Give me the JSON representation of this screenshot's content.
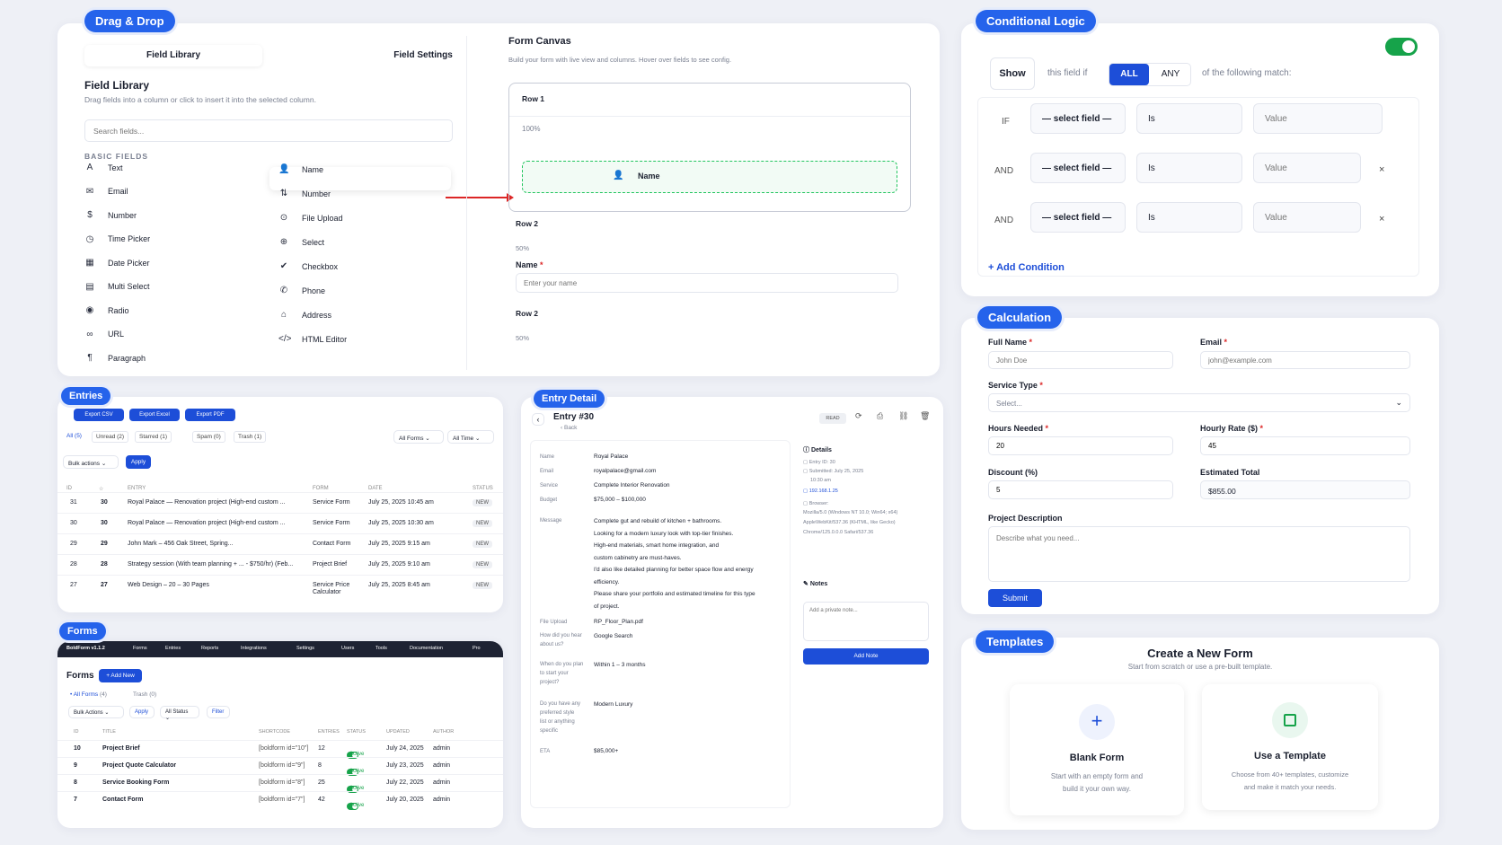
{
  "dragdrop": {
    "pill": "Drag & Drop",
    "tabs": [
      "Field Library",
      "Field Settings"
    ],
    "library_title": "Field Library",
    "library_desc": "Drag fields into a column or click to insert it into the selected column.",
    "search_placeholder": "Search fields...",
    "section": "BASIC FIELDS",
    "left_fields": [
      {
        "icon": "A",
        "label": "Text"
      },
      {
        "icon": "✉",
        "label": "Email"
      },
      {
        "icon": "$",
        "label": "Number"
      },
      {
        "icon": "◷",
        "label": "Time Picker"
      },
      {
        "icon": "▦",
        "label": "Date Picker"
      },
      {
        "icon": "▤",
        "label": "Multi Select"
      },
      {
        "icon": "◉",
        "label": "Radio"
      },
      {
        "icon": "∞",
        "label": "URL"
      },
      {
        "icon": "¶",
        "label": "Paragraph"
      }
    ],
    "right_fields": [
      {
        "icon": "👤",
        "label": "Name"
      },
      {
        "icon": "⇅",
        "label": "Number"
      },
      {
        "icon": "⊙",
        "label": "File Upload"
      },
      {
        "icon": "⊕",
        "label": "Select"
      },
      {
        "icon": "✔",
        "label": "Checkbox"
      },
      {
        "icon": "✆",
        "label": "Phone"
      },
      {
        "icon": "⌂",
        "label": "Address"
      },
      {
        "icon": "</>",
        "label": "HTML Editor"
      }
    ],
    "canvas_title": "Form Canvas",
    "canvas_desc": "Build your form with live view and columns. Hover over fields to see config.",
    "row1": "Row 1",
    "row1_width": "100%",
    "drop_label": "Name",
    "row2": "Row 2",
    "row2_width": "50%",
    "name_label": "Name",
    "name_placeholder": "Enter your name",
    "row3": "Row 2",
    "row3_width": "50%"
  },
  "conditional": {
    "pill": "Conditional Logic",
    "show": "Show",
    "this_field_if": "this field if",
    "all": "ALL",
    "any": "ANY",
    "of_following": "of the following match:",
    "rows": [
      {
        "op": "IF",
        "field": "— select field —",
        "cond": "Is",
        "value": "Value",
        "remove": ""
      },
      {
        "op": "AND",
        "field": "— select field —",
        "cond": "Is",
        "value": "Value",
        "remove": "×"
      },
      {
        "op": "AND",
        "field": "— select field —",
        "cond": "Is",
        "value": "Value",
        "remove": "×"
      }
    ],
    "add_condition": "+ Add Condition"
  },
  "calculation": {
    "pill": "Calculation",
    "full_name_label": "Full Name",
    "full_name_ph": "John Doe",
    "email_label": "Email",
    "email_ph": "john@example.com",
    "service_label": "Service Type",
    "service_ph": "Select...",
    "hours_label": "Hours Needed",
    "hours_val": "20",
    "rate_label": "Hourly Rate ($)",
    "rate_val": "45",
    "discount_label": "Discount (%)",
    "discount_val": "5",
    "total_label": "Estimated Total",
    "total_val": "$855.00",
    "desc_label": "Project Description",
    "desc_ph": "Describe what you need...",
    "submit": "Submit",
    "req": "*"
  },
  "templates": {
    "pill": "Templates",
    "title": "Create a New Form",
    "subtitle": "Start from scratch or use a pre-built template.",
    "blank_title": "Blank Form",
    "blank_desc1": "Start with an empty form and",
    "blank_desc2": "build it your own way.",
    "tpl_title": "Use a Template",
    "tpl_desc1": "Choose from 40+ templates, customize",
    "tpl_desc2": "and make it match your needs."
  },
  "entries": {
    "pill": "Entries",
    "exports": [
      "Export CSV",
      "Export Excel",
      "Export PDF"
    ],
    "filters": [
      "All (5)",
      "Unread (2)",
      "Starred (1)",
      "Spam (0)",
      "Trash (1)"
    ],
    "all_forms": "All Forms",
    "all_time": "All Time",
    "bulk": "Bulk actions",
    "apply": "Apply",
    "headers": [
      "ID",
      "☆",
      "ENTRY",
      "FORM",
      "DATE",
      "STATUS"
    ],
    "rows": [
      {
        "id": "31",
        "num": "30",
        "entry": "Royal Palace — Renovation project (High-end custom ...",
        "form": "Service Form",
        "date": "July 25, 2025 10:45 am",
        "status": "NEW"
      },
      {
        "id": "30",
        "num": "30",
        "entry": "Royal Palace — Renovation project (High-end custom ...",
        "form": "Service Form",
        "date": "July 25, 2025 10:30 am",
        "status": "NEW"
      },
      {
        "id": "29",
        "num": "29",
        "entry": "John Mark – 456 Oak Street, Spring...",
        "form": "Contact Form",
        "date": "July 25, 2025 9:15 am",
        "status": "NEW"
      },
      {
        "id": "28",
        "num": "28",
        "entry": "Strategy session (With team planning + ... - $750/hr) (Feb...",
        "form": "Project Brief",
        "date": "July 25, 2025 9:10 am",
        "status": "NEW"
      },
      {
        "id": "27",
        "num": "27",
        "entry": "Web Design – 20 – 30 Pages",
        "form": "Service Price Calculator",
        "date": "July 25, 2025 8:45 am",
        "status": "NEW"
      }
    ]
  },
  "forms": {
    "pill": "Forms",
    "nav": [
      "BoldForm v1.1.2",
      "Forms",
      "Entries",
      "Reports",
      "Integrations",
      "Settings",
      "Users",
      "Tools",
      "Documentation",
      "Pro"
    ],
    "title": "Forms",
    "add_new": "+ Add New",
    "all_forms": "• All Forms",
    "all_count": "(4)",
    "trash": "Trash",
    "trash_count": "(0)",
    "bulk": "Bulk Actions",
    "apply": "Apply",
    "all_status": "All Status",
    "filter": "Filter",
    "headers": [
      "ID",
      "TITLE",
      "SHORTCODE",
      "ENTRIES",
      "STATUS",
      "UPDATED",
      "AUTHOR"
    ],
    "rows": [
      {
        "id": "10",
        "title": "Project Brief",
        "code": "[boldform id=\"10\"]",
        "entries": "12",
        "status": "Active",
        "updated": "July 24, 2025",
        "author": "admin"
      },
      {
        "id": "9",
        "title": "Project Quote Calculator",
        "code": "[boldform id=\"9\"]",
        "entries": "8",
        "status": "Active",
        "updated": "July 23, 2025",
        "author": "admin"
      },
      {
        "id": "8",
        "title": "Service Booking Form",
        "code": "[boldform id=\"8\"]",
        "entries": "25",
        "status": "Active",
        "updated": "July 22, 2025",
        "author": "admin"
      },
      {
        "id": "7",
        "title": "Contact Form",
        "code": "[boldform id=\"7\"]",
        "entries": "42",
        "status": "Active",
        "updated": "July 20, 2025",
        "author": "admin"
      }
    ]
  },
  "entry_detail": {
    "pill": "Entry Detail",
    "title": "Entry #30",
    "back": "Back",
    "read": "READ",
    "fields": [
      {
        "k": "Name",
        "v": "Royal Palace"
      },
      {
        "k": "Email",
        "v": "royalpalace@gmail.com"
      },
      {
        "k": "Service",
        "v": "Complete Interior Renovation"
      },
      {
        "k": "Budget",
        "v": "$75,000 – $100,000"
      }
    ],
    "message_label": "Message",
    "message_lines": [
      "Complete gut and rebuild of kitchen + bathrooms.",
      "Looking for a modern luxury look with top-tier finishes.",
      "High-end materials, smart home integration, and",
      "custom cabinetry are must-haves.",
      "I'd also like detailed planning for better space flow and energy",
      "efficiency.",
      "Please share your portfolio and estimated timeline for this type",
      "of project."
    ],
    "file_label": "File Upload",
    "file_value": "RP_Floor_Plan.pdf",
    "hear_label1": "How did you hear",
    "hear_label2": "about us?",
    "hear_value": "Google Search",
    "plan_label1": "When do you plan",
    "plan_label2": "to start your",
    "plan_label3": "project?",
    "plan_value": "Within 1 – 3 months",
    "style_label1": "Do you have any",
    "style_label2": "preferred style",
    "style_label3": "list or anything",
    "style_label4": "specific",
    "style_value": "Modern Luxury",
    "eta_label": "ETA",
    "eta_value": "$85,000+",
    "details_title": "Details",
    "entry_id": "Entry ID: 30",
    "submitted": "Submitted: July 25, 2025",
    "submitted_time": "10:30 am",
    "ip": "192.168.1.25",
    "browser_label": "Browser:",
    "browser1": "Mozilla/5.0 (Windows NT 10.0; Win64; x64)",
    "browser2": "AppleWebKit/537.36 (KHTML, like Gecko)",
    "browser3": "Chrome/125.0.0.0 Safari/537.36",
    "notes_title": "Notes",
    "note_ph": "Add a private note...",
    "add_note": "Add Note"
  }
}
